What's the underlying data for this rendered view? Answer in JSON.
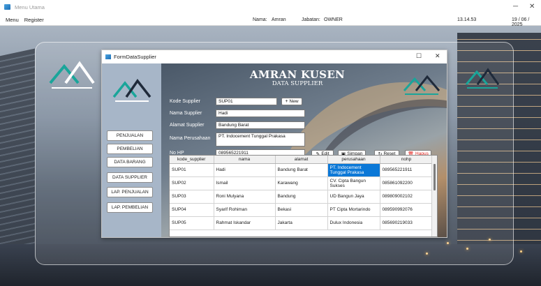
{
  "window": {
    "title": "Menu Utama",
    "minimize_glyph": "─",
    "close_glyph": "✕"
  },
  "menubar": {
    "items": [
      "Menu",
      "Register"
    ],
    "nama_label": "Nama:",
    "nama_value": "Amran",
    "jabatan_label": "Jabatan:",
    "jabatan_value": "OWNER",
    "time": "13.14.53",
    "date": "19 / 06 / 2025"
  },
  "form": {
    "title": "FormDataSupplier",
    "maximize_glyph": "☐",
    "close_glyph": "✕"
  },
  "header": {
    "title": "AMRAN KUSEN",
    "subtitle": "DATA SUPPLIER"
  },
  "nav": {
    "items": [
      "PENJUALAN",
      "PEMBELIAN",
      "DATA BARANG",
      "DATA SUPPLIER",
      "LAP. PENJUALAN",
      "LAP. PEMBELIAN"
    ]
  },
  "fields": {
    "kode_label": "Kode Supplier",
    "kode_value": "SUP01",
    "nama_label": "Nama Supplier",
    "nama_value": "Hadi",
    "alamat_label": "Alamat Supplier",
    "alamat_value": "Bandung Barat",
    "perusahaan_label": "Nama Perusahaan",
    "perusahaan_value": "PT. Indocement Tunggal Prakasa",
    "nohp_label": "No HP",
    "nohp_value": "089565221911"
  },
  "buttons": {
    "new_label": "New",
    "edit_label": "Edit",
    "simpan_label": "Simpan",
    "reset_label": "Reset",
    "hapus_label": "Hapus"
  },
  "table": {
    "columns": [
      "kode_supplier",
      "nama",
      "alamat",
      "perusahaan",
      "nohp"
    ],
    "rows": [
      [
        "SUP01",
        "Hadi",
        "Bandung Barat",
        "PT. Indocement Tunggal Prakasa",
        "089565221911"
      ],
      [
        "SUP02",
        "Ismail",
        "Karawang",
        "CV. Cipta Bangun Sukses",
        "085861092200"
      ],
      [
        "SUP03",
        "Roni Mulyana",
        "Bandung",
        "UD Bangun Jaya",
        "089809002102"
      ],
      [
        "SUP04",
        "Syarif Rohiman",
        "Bekasi",
        "PT Cipta Mortarindo",
        "089590992076"
      ],
      [
        "SUP05",
        "Rahmat Iskandar",
        "Jakarta",
        "Dulux Indonesia",
        "085690219033"
      ]
    ]
  },
  "colors": {
    "selection": "#0b78d7",
    "hapus": "#e0201b",
    "left_panel": "#a7b6c8",
    "logo_teal": "#1aa59a",
    "logo_dark": "#1f2a3a"
  }
}
